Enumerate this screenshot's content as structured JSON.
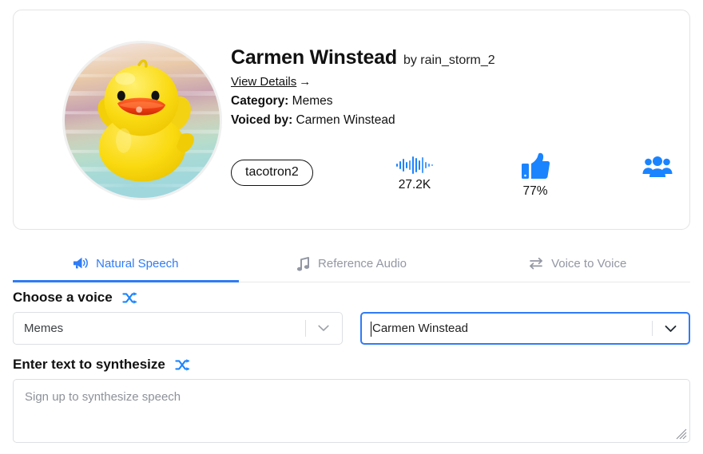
{
  "profile": {
    "voice_name": "Carmen Winstead",
    "byline": "by rain_storm_2",
    "view_details_label": "View Details",
    "view_details_arrow": "→",
    "category_key": "Category:",
    "category_value": "Memes",
    "voiced_by_key": "Voiced by:",
    "voiced_by_value": "Carmen Winstead",
    "avatar_alt": "rubber-duck-avatar"
  },
  "stats": {
    "model_badge": "tacotron2",
    "waveform_icon": "waveform-icon",
    "plays_count": "27.2K",
    "likes_icon": "thumbs-up-icon",
    "likes_percent": "77%",
    "users_icon": "people-group-icon"
  },
  "tabs": [
    {
      "label": "Natural Speech",
      "icon": "megaphone-icon",
      "active": true
    },
    {
      "label": "Reference Audio",
      "icon": "music-note-icon",
      "active": false
    },
    {
      "label": "Voice to Voice",
      "icon": "swap-arrows-icon",
      "active": false
    }
  ],
  "form": {
    "choose_voice_label": "Choose a voice",
    "shuffle_icon": "shuffle-icon",
    "category_select_value": "Memes",
    "voice_select_value": "Carmen Winstead",
    "enter_text_label": "Enter text to synthesize",
    "textarea_placeholder": "Sign up to synthesize speech"
  },
  "colors": {
    "accent_blue": "#2f7cf6",
    "icon_blue": "#1a84ff",
    "muted_tab": "#9397a3",
    "border": "#dcdfe4"
  }
}
